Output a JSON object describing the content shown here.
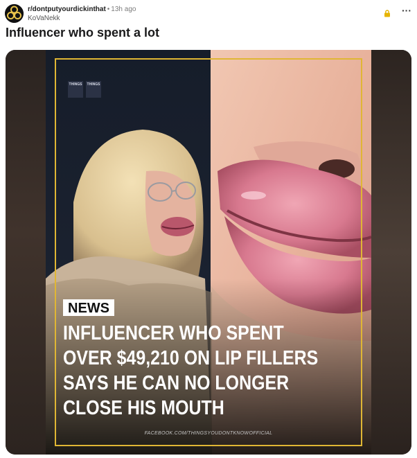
{
  "post": {
    "subreddit": "r/dontputyourdickinthat",
    "separator": "•",
    "age": "13h ago",
    "author": "KoVaNekk",
    "title": "Influencer who spent a lot",
    "more_label": "···"
  },
  "media": {
    "logo_tiles": [
      "THINGS",
      "THINGS"
    ],
    "badge": "NEWS",
    "headline_lines": [
      "INFLUENCER WHO SPENT",
      "OVER $49,210 ON LIP FILLERS",
      "SAYS HE CAN NO LONGER",
      "CLOSE HIS MOUTH"
    ],
    "credit": "FACEBOOK.COM/THINGSYOUDONTKNOWOFFICIAL"
  },
  "icons": {
    "lock": "lock-icon",
    "more": "more-options-icon",
    "avatar": "subreddit-avatar"
  },
  "colors": {
    "frame": "#e0b634",
    "lock": "#e6b400",
    "badge_bg": "#ffffff",
    "headline": "#ffffff"
  }
}
